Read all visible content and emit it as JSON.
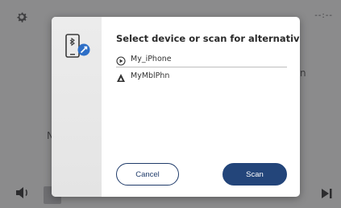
{
  "background": {
    "gear_icon": "gear-icon",
    "status_text": "--:--",
    "left_letter": "N",
    "right_letter": "n",
    "volume_icon": "volume-icon",
    "next_icon": "skip-next-icon"
  },
  "dialog": {
    "icon": "phone-bluetooth-icon",
    "title": "Select device or scan for alternatives",
    "devices": [
      {
        "label": "My_iPhone",
        "icon": "play-circle-icon",
        "selected": true
      },
      {
        "label": "MyMblPhn",
        "icon": "android-icon",
        "selected": false
      }
    ],
    "cancel_label": "Cancel",
    "scan_label": "Scan"
  },
  "colors": {
    "accent": "#23457a",
    "accent_border": "#1f3b6a",
    "overlay": "#8b8b8c",
    "bt_badge": "#2e6fc7"
  }
}
